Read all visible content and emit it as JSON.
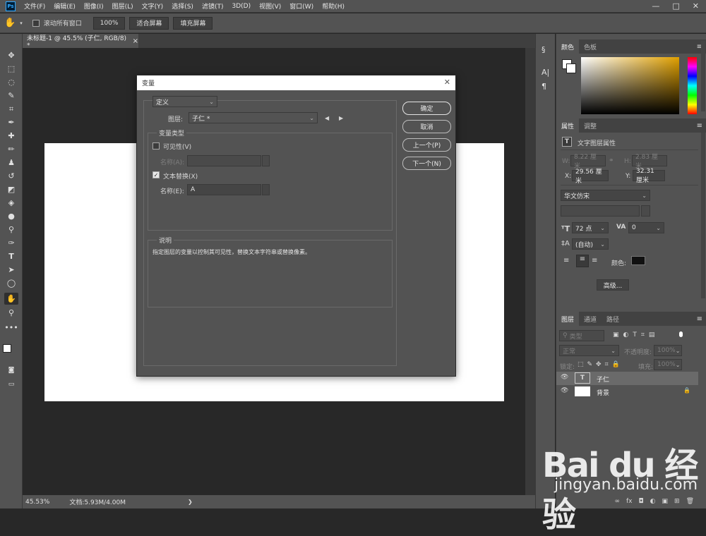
{
  "app": {
    "logo": "Ps",
    "menus": [
      "文件(F)",
      "编辑(E)",
      "图像(I)",
      "图层(L)",
      "文字(Y)",
      "选择(S)",
      "滤镜(T)",
      "3D(D)",
      "视图(V)",
      "窗口(W)",
      "帮助(H)"
    ],
    "window_controls": [
      "—",
      "□",
      "✕"
    ]
  },
  "options_bar": {
    "scroll_all_label": "滚动所有窗口",
    "zoom_value": "100%",
    "fit_screen": "适合屏幕",
    "fill_screen": "填充屏幕"
  },
  "document": {
    "tab_title": "未标题-1 @ 45.5% (子仁, RGB/8) *",
    "tab_close": "×",
    "zoom": "45.53%",
    "doc_info": "文档:5.93M/4.00M",
    "arrow": "❯"
  },
  "dialog": {
    "title": "变量",
    "close": "✕",
    "define_select": "定义",
    "layer_label": "图层:",
    "layer_value": "子仁 *",
    "prev_arrow": "◀",
    "next_arrow": "▶",
    "var_type_legend": "变量类型",
    "visibility_label": "可见性(V)",
    "visibility_name_label": "名称(A):",
    "text_replace_label": "文本替换(X)",
    "text_name_label": "名称(E):",
    "text_name_value": "A",
    "desc_legend": "说明",
    "desc_text": "指定图层的变量以控制其可见性，替换文本字符串或替换像素。",
    "ok": "确定",
    "cancel": "取消",
    "prev": "上一个(P)",
    "next": "下一个(N)"
  },
  "color_panel": {
    "tabs": [
      "颜色",
      "色板"
    ],
    "menu_icon": "≡"
  },
  "properties_panel": {
    "tabs": [
      "属性",
      "调整"
    ],
    "header": "文字图层属性",
    "w_label": "W:",
    "w_value": "8.22 厘米",
    "h_label": "H:",
    "h_value": "2.83 厘米",
    "x_label": "X:",
    "x_value": "29.56 厘米",
    "y_label": "Y:",
    "y_value": "32.31 厘米",
    "font_family": "华文仿宋",
    "font_size": "72 点",
    "tracking": "0",
    "leading": "(自动)",
    "color_label": "颜色:",
    "advanced": "高级..."
  },
  "layers_panel": {
    "tabs": [
      "图层",
      "通道",
      "路径"
    ],
    "filter_kind": "类型",
    "blend_mode": "正常",
    "opacity_label": "不透明度:",
    "opacity_value": "100%",
    "lock_label": "锁定:",
    "fill_label": "填充:",
    "fill_value": "100%",
    "layers": [
      {
        "name": "子仁",
        "type": "T"
      },
      {
        "name": "背景",
        "type": "bg"
      }
    ],
    "bottom_icons": [
      "∞",
      "fx",
      "◘",
      "◐",
      "▣",
      "⊞",
      "🗑"
    ]
  },
  "watermark": {
    "brand": "Bai du 经验",
    "url": "jingyan.baidu.com"
  }
}
